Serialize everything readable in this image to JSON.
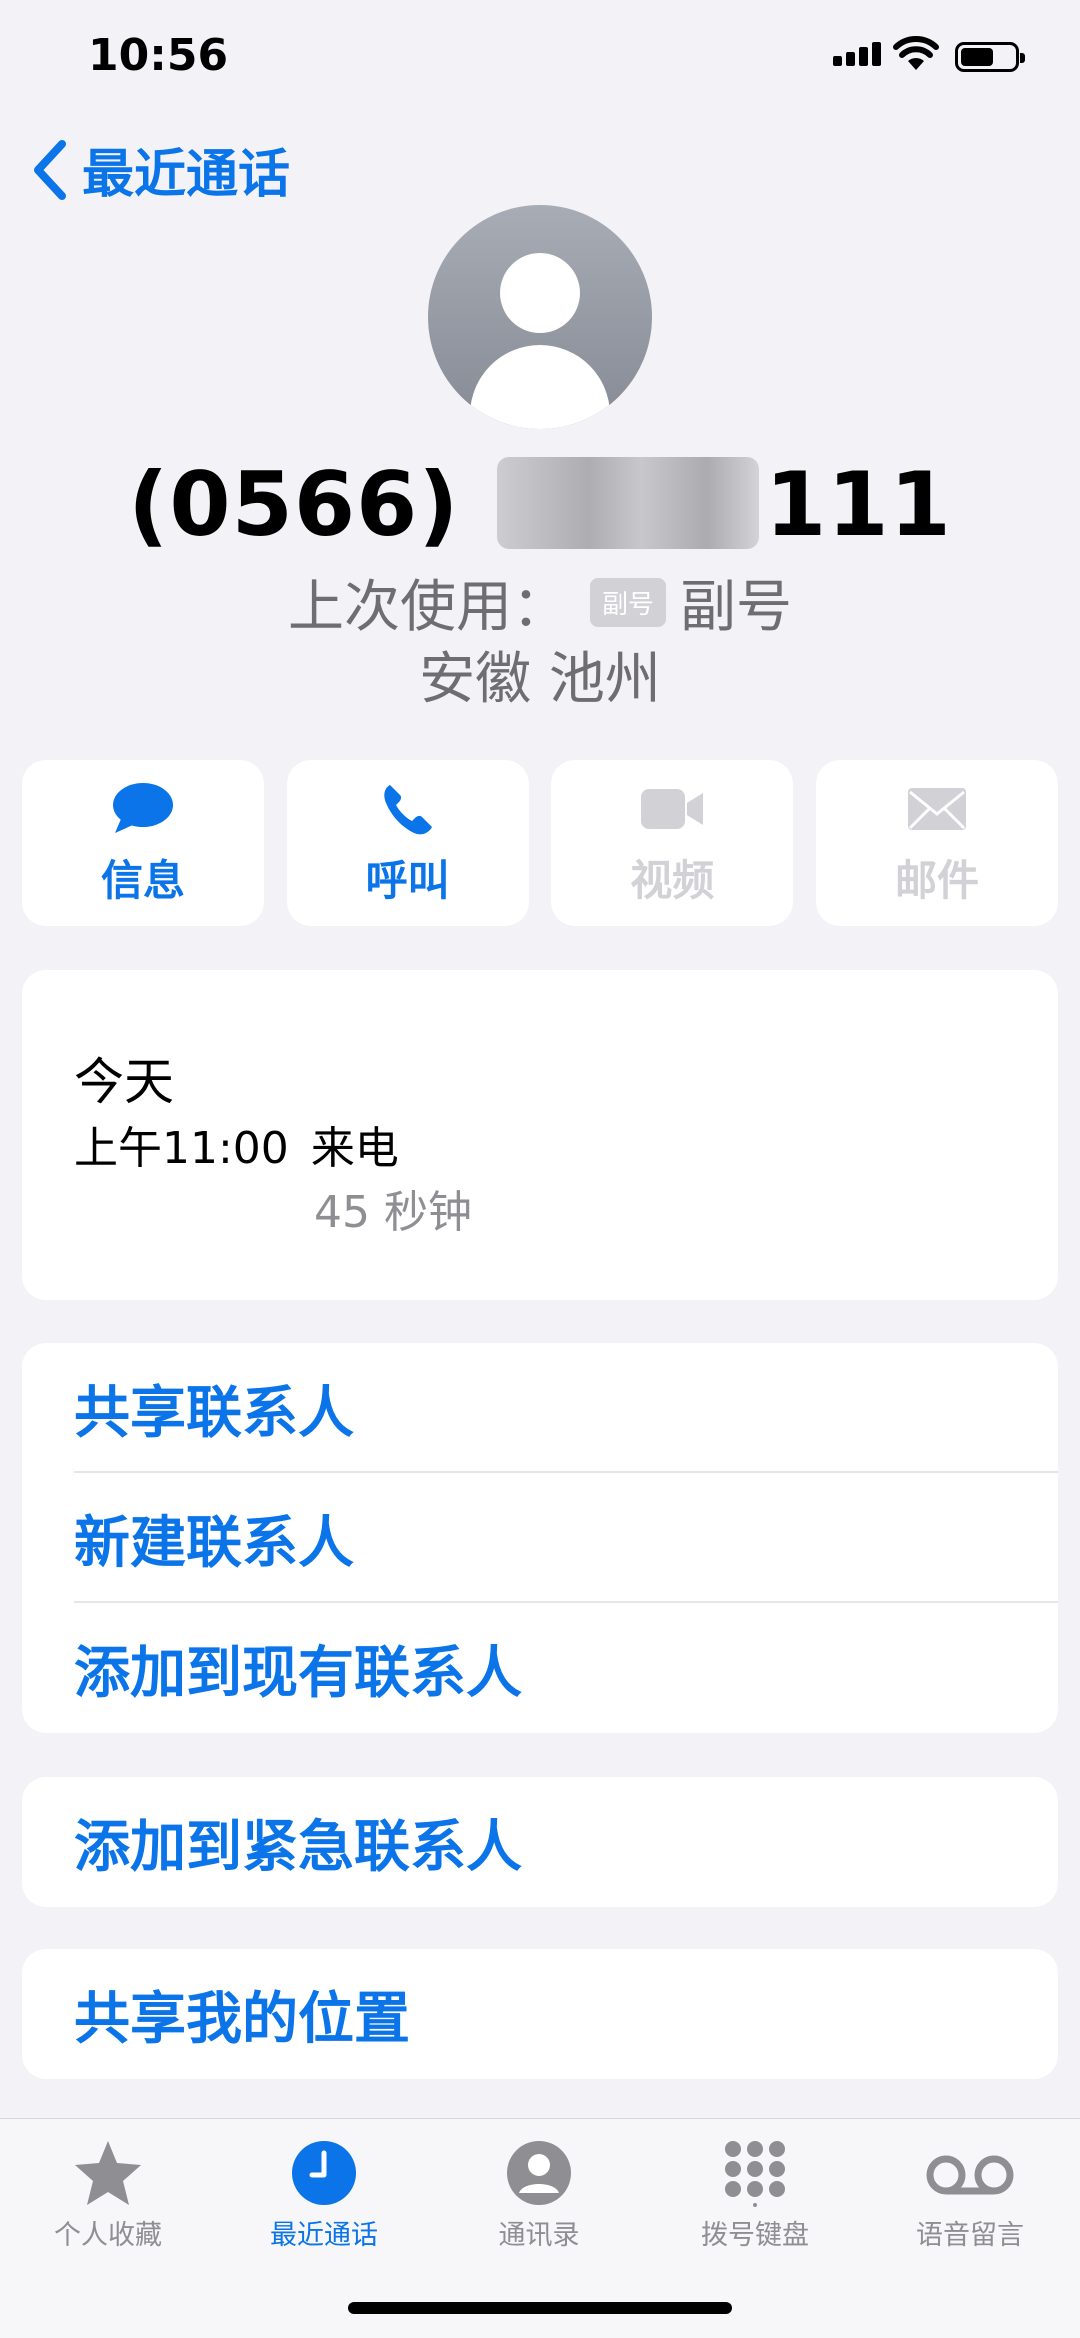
{
  "status": {
    "time": "10:56"
  },
  "nav": {
    "back_label": "最近通话"
  },
  "contact": {
    "number_prefix": "(0566) ",
    "number_suffix": "111",
    "last_used_label": "上次使用：",
    "line_badge": "副号",
    "line_name": "副号",
    "location": "安徽 池州"
  },
  "actions": [
    {
      "label": "信息",
      "icon": "message-bubble-icon",
      "enabled": true
    },
    {
      "label": "呼叫",
      "icon": "phone-icon",
      "enabled": true
    },
    {
      "label": "视频",
      "icon": "video-camera-icon",
      "enabled": false
    },
    {
      "label": "邮件",
      "icon": "envelope-icon",
      "enabled": false
    }
  ],
  "history": {
    "day": "今天",
    "time": "上午11:00",
    "type": "来电",
    "duration": "45 秒钟"
  },
  "options_group1": [
    "共享联系人",
    "新建联系人",
    "添加到现有联系人"
  ],
  "options_group2": [
    "添加到紧急联系人"
  ],
  "options_group3": [
    "共享我的位置"
  ],
  "tabs": [
    {
      "label": "个人收藏",
      "icon": "star-icon",
      "active": false
    },
    {
      "label": "最近通话",
      "icon": "clock-icon",
      "active": true
    },
    {
      "label": "通讯录",
      "icon": "contacts-icon",
      "active": false
    },
    {
      "label": "拨号键盘",
      "icon": "keypad-icon",
      "active": false
    },
    {
      "label": "语音留言",
      "icon": "voicemail-icon",
      "active": false
    }
  ],
  "colors": {
    "accent": "#0a74e8",
    "background": "#f2f2f7",
    "disabled": "#d1d1d6",
    "secondary": "#8e8e93"
  }
}
